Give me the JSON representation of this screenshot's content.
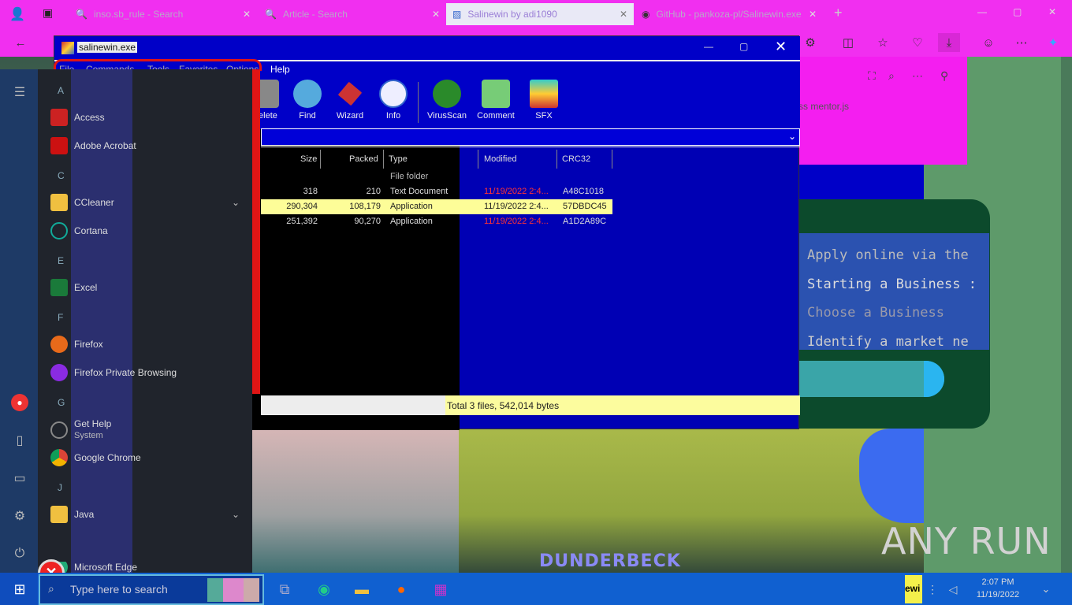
{
  "browser": {
    "tabs": [
      {
        "label": "inso.sb_rule - Search"
      },
      {
        "label": "Article - Search"
      },
      {
        "label": "Salinewin by adi1090"
      },
      {
        "label": "GitHub - pankoza-pl/Salinewin.exe"
      }
    ]
  },
  "page": {
    "pink_text": "ss mentor.js",
    "card_lines": [
      "Apply online via the",
      "Starting a Business :",
      "Choose a Business",
      "Identify a market ne"
    ],
    "lower_text": "DUNDERBECK",
    "watermark": "ANY  RUN"
  },
  "winrar": {
    "title": "salinewin.exe",
    "menu": [
      "File",
      "Commands",
      "Tools",
      "Favorites",
      "Options",
      "Help"
    ],
    "tools": [
      "Delete",
      "Find",
      "Wizard",
      "Info",
      "VirusScan",
      "Comment",
      "SFX"
    ],
    "columns": [
      "Size",
      "Packed",
      "Type",
      "Modified",
      "CRC32"
    ],
    "rows": [
      {
        "size": "",
        "packed": "",
        "type": "File folder",
        "modified": "",
        "crc": ""
      },
      {
        "size": "318",
        "packed": "210",
        "type": "Text Document",
        "modified": "11/19/2022 2:4...",
        "crc": "A48C1018"
      },
      {
        "size": "290,304",
        "packed": "108,179",
        "type": "Application",
        "modified": "11/19/2022 2:4...",
        "crc": "57DBDC45"
      },
      {
        "size": "251,392",
        "packed": "90,270",
        "type": "Application",
        "modified": "11/19/2022 2:4...",
        "crc": "A1D2A89C"
      }
    ],
    "status": "Total 3 files, 542,014 bytes"
  },
  "startmenu": {
    "letters": [
      "A",
      "C",
      "E",
      "F",
      "G",
      "J"
    ],
    "items": [
      {
        "label": "Access",
        "color": "#c22"
      },
      {
        "label": "Adobe Acrobat",
        "color": "#c11"
      },
      {
        "label": "CCleaner",
        "color": "#f0c040"
      },
      {
        "label": "Cortana",
        "color": "#1a9"
      },
      {
        "label": "Excel",
        "color": "#1a7a3a"
      },
      {
        "label": "Firefox",
        "color": "#e86a1a"
      },
      {
        "label": "Firefox Private Browsing",
        "color": "#8a2be2"
      },
      {
        "label": "Get Help",
        "sub": "System",
        "color": "#555"
      },
      {
        "label": "Google Chrome",
        "color": "#e0b020"
      },
      {
        "label": "Java",
        "color": "#f0c040"
      },
      {
        "label": "Microsoft Edge",
        "color": "#2a7"
      }
    ]
  },
  "taskbar": {
    "search_placeholder": "Type here to search",
    "tray_label": "ewi",
    "time": "2:07 PM",
    "date": "11/19/2022"
  }
}
